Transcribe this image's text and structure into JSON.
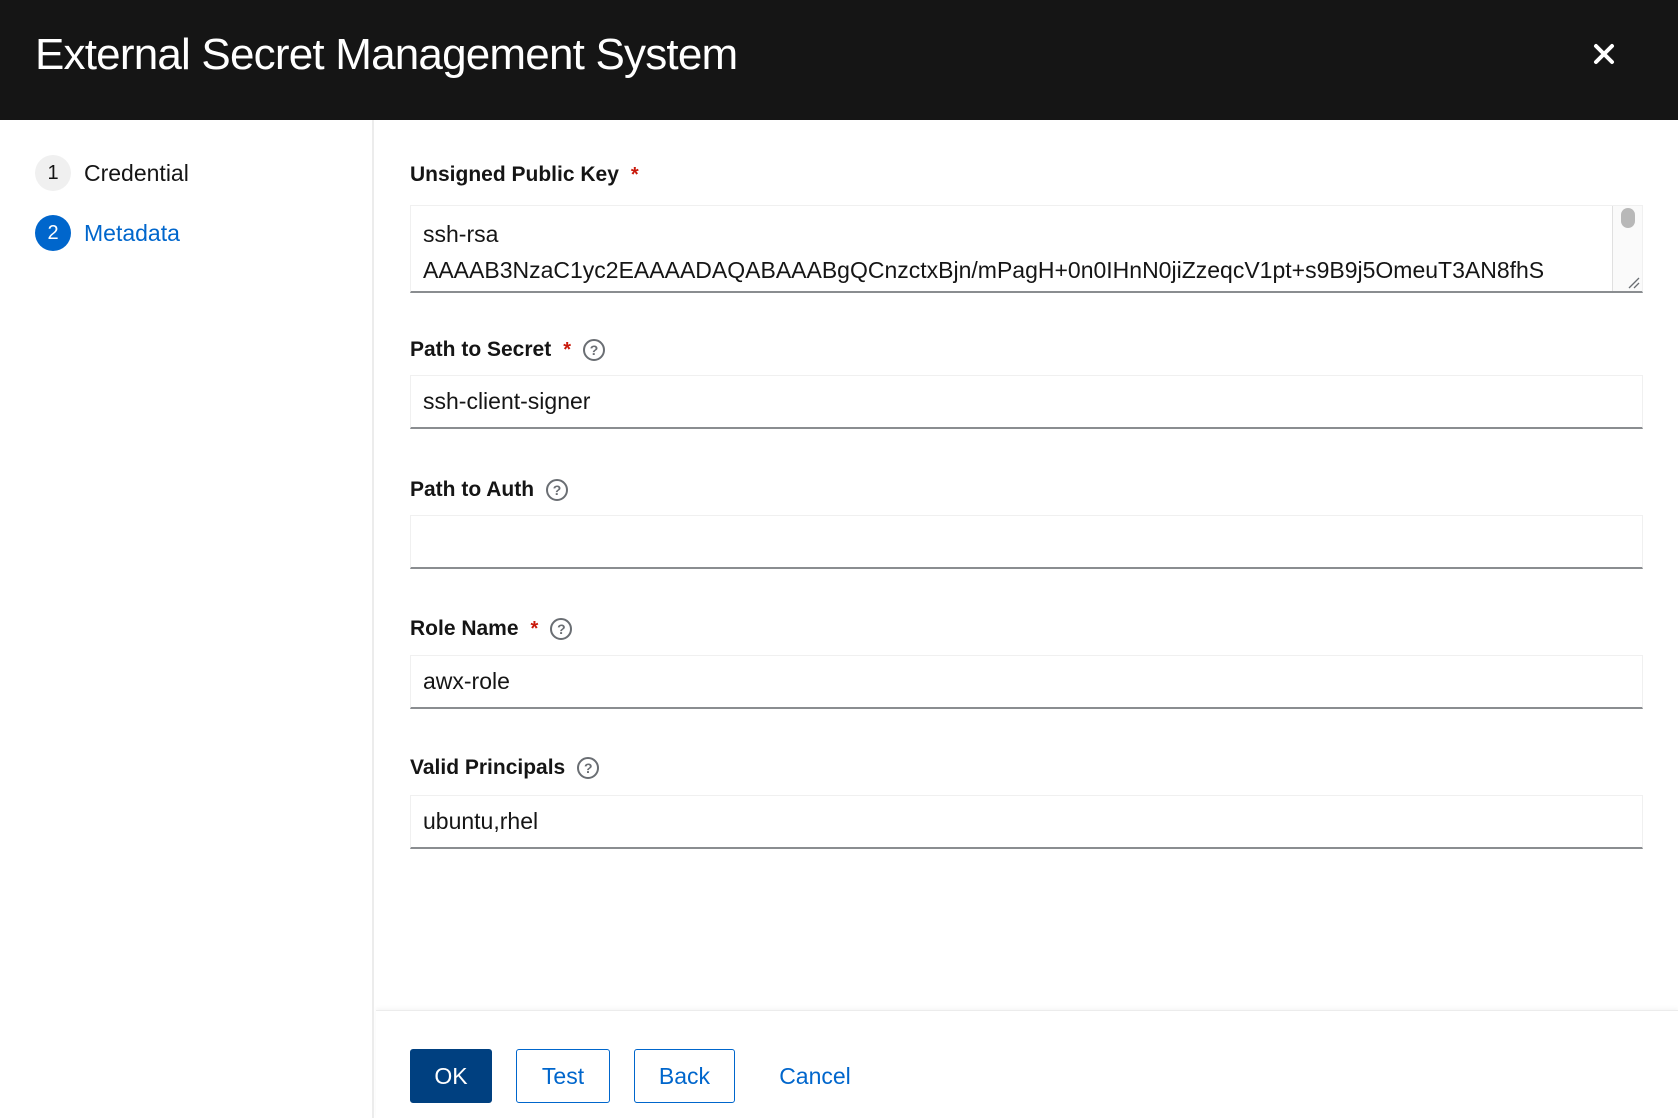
{
  "header": {
    "title": "External Secret Management System",
    "close_icon": "close-icon"
  },
  "nav": {
    "items": [
      {
        "number": "1",
        "label": "Credential",
        "current": false
      },
      {
        "number": "2",
        "label": "Metadata",
        "current": true
      }
    ]
  },
  "form": {
    "public_key": {
      "label": "Unsigned Public Key",
      "required": "*",
      "value_line1": "ssh-rsa",
      "value_line2": "AAAAB3NzaC1yc2EAAAADAQABAAABgQCnzctxBjn/mPagH+0n0IHnN0jiZzeqcV1pt+s9B9j5OmeuT3AN8fhS"
    },
    "path_to_secret": {
      "label": "Path to Secret",
      "required": "*",
      "value": "ssh-client-signer"
    },
    "path_to_auth": {
      "label": "Path to Auth",
      "value": ""
    },
    "role_name": {
      "label": "Role Name",
      "required": "*",
      "value": "awx-role"
    },
    "valid_principals": {
      "label": "Valid Principals",
      "value": "ubuntu,rhel"
    },
    "help_glyph": "?"
  },
  "footer": {
    "ok_label": "OK",
    "test_label": "Test",
    "back_label": "Back",
    "cancel_label": "Cancel"
  },
  "colors": {
    "header_bg": "#151515",
    "accent": "#0066cc",
    "primary_button": "#004080",
    "required": "#c9190b"
  }
}
